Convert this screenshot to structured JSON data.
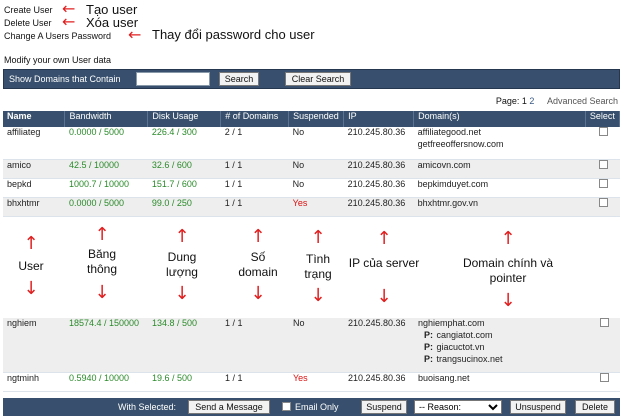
{
  "menu": {
    "create_user": "Create User",
    "delete_user": "Delete User",
    "change_password": "Change A Users Password"
  },
  "annotations_top": {
    "create": "Tạo user",
    "delete": "Xóa user",
    "password": "Thay đổi password cho user"
  },
  "modify_text": "Modify your own User data",
  "search": {
    "label": "Show Domains that Contain",
    "value": "",
    "search_button": "Search",
    "clear_button": "Clear Search"
  },
  "pagination": {
    "label": "Page:",
    "current": "1",
    "next": "2",
    "advanced": "Advanced Search"
  },
  "columns": [
    "Name",
    "Bandwidth",
    "Disk Usage",
    "# of Domains",
    "Suspended",
    "IP",
    "Domain(s)",
    "Select"
  ],
  "rows_top": [
    {
      "name": "affiliateg",
      "bandwidth": "0.0000 / 5000",
      "disk": "226.4 / 300",
      "domains": "2 / 1",
      "suspended": "No",
      "ip": "210.245.80.36",
      "domain_main": "affiliategood.net",
      "domain_extra": "getfreeoffersnow.com"
    },
    {
      "name": "amico",
      "bandwidth": "42.5 / 10000",
      "disk": "32.6 / 600",
      "domains": "1 / 1",
      "suspended": "No",
      "ip": "210.245.80.36",
      "domain_main": "amicovn.com"
    },
    {
      "name": "bepkd",
      "bandwidth": "1000.7 / 10000",
      "disk": "151.7 / 600",
      "domains": "1 / 1",
      "suspended": "No",
      "ip": "210.245.80.36",
      "domain_main": "bepkimduyet.com"
    },
    {
      "name": "bhxhtmr",
      "bandwidth": "0.0000 / 5000",
      "disk": "99.0 / 250",
      "domains": "1 / 1",
      "suspended": "Yes",
      "ip": "210.245.80.36",
      "domain_main": "bhxhtmr.gov.vn"
    }
  ],
  "middle_labels": {
    "user": "User",
    "bandwidth": [
      "Băng",
      "thông"
    ],
    "disk": [
      "Dung",
      "lượng"
    ],
    "domains": [
      "Số",
      "domain"
    ],
    "status": [
      "Tình",
      "trạng"
    ],
    "ip": "IP của server",
    "domain": [
      "Domain chính và",
      "pointer"
    ]
  },
  "rows_bottom": [
    {
      "name": "nghiem",
      "bandwidth": "18574.4 / 150000",
      "disk": "134.8 / 500",
      "domains": "1 / 1",
      "suspended": "No",
      "ip": "210.245.80.36",
      "domain_main": "nghiemphat.com",
      "pointers": [
        {
          "prefix": "P:",
          "domain": "cangiatot.com"
        },
        {
          "prefix": "P:",
          "domain": "giacuctot.vn"
        },
        {
          "prefix": "P:",
          "domain": "trangsucinox.net"
        }
      ]
    },
    {
      "name": "ngtminh",
      "bandwidth": "0.5940 / 10000",
      "disk": "19.6 / 500",
      "domains": "1 / 1",
      "suspended": "Yes",
      "ip": "210.245.80.36",
      "domain_main": "buoisang.net"
    }
  ],
  "footer": {
    "with_selected": "With Selected:",
    "send_message": "Send a Message",
    "email_only": "Email Only",
    "suspend": "Suspend",
    "reason": "-- Reason:",
    "unsuspend": "Unsuspend",
    "delete": "Delete"
  },
  "colors": {
    "header_bg": "#38506d",
    "green": "#2a8a2a",
    "red": "#dd1111",
    "arrow": "#e02020"
  },
  "icons": {
    "arrow": "red-arrow-icon"
  }
}
